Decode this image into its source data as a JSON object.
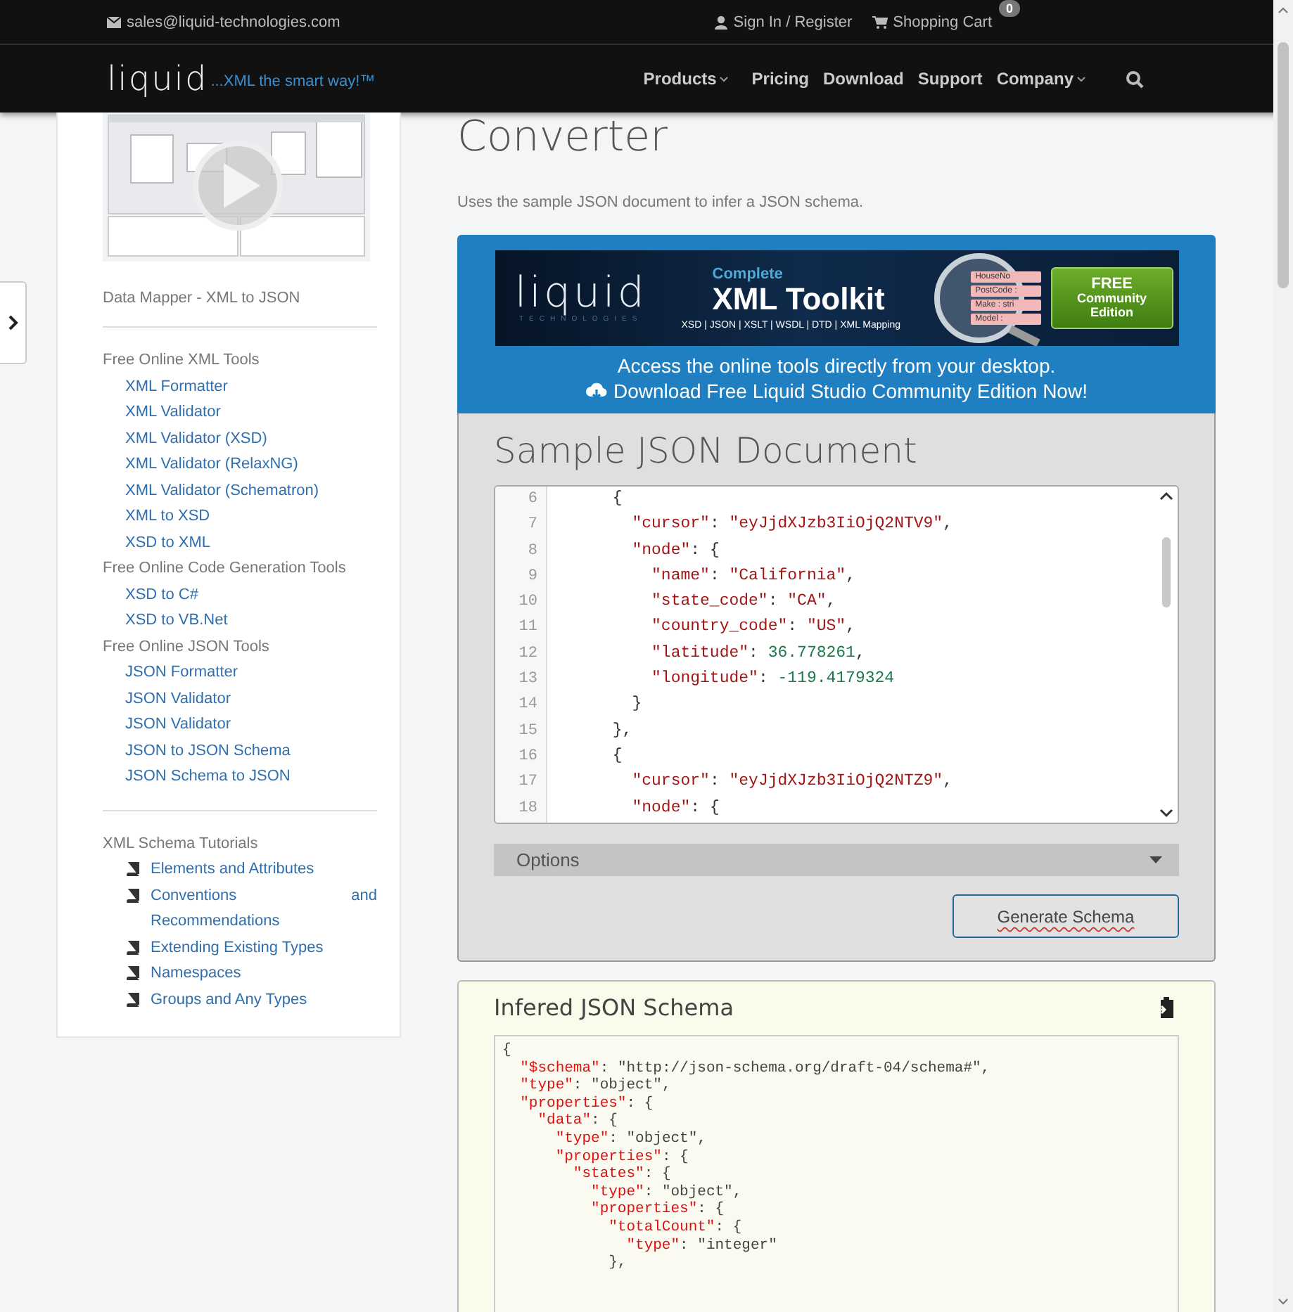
{
  "topbar": {
    "email": "sales@liquid-technologies.com",
    "sign_in": "Sign In / Register",
    "cart": "Shopping Cart",
    "cart_count": "0"
  },
  "header": {
    "logo": "liquid",
    "tagline": "...XML the smart way!™"
  },
  "nav": [
    {
      "label": "Products",
      "dropdown": true
    },
    {
      "label": "Pricing",
      "dropdown": false
    },
    {
      "label": "Download",
      "dropdown": false
    },
    {
      "label": "Support",
      "dropdown": false
    },
    {
      "label": "Company",
      "dropdown": true
    }
  ],
  "sidebar": {
    "video_caption": "Data Mapper - XML to JSON",
    "groups": [
      {
        "title": "Free Online XML Tools",
        "links": [
          "XML Formatter",
          "XML Validator",
          "XML Validator (XSD)",
          "XML Validator (RelaxNG)",
          "XML Validator (Schematron)",
          "XML to XSD",
          "XSD to XML"
        ]
      },
      {
        "title": "Free Online Code Generation Tools",
        "links": [
          "XSD to C#",
          "XSD to VB.Net"
        ]
      },
      {
        "title": "Free Online JSON Tools",
        "links": [
          "JSON Formatter",
          "JSON Validator",
          "JSON Validator",
          "JSON to JSON Schema",
          "JSON Schema to JSON"
        ]
      }
    ],
    "tutorials": {
      "title": "XML Schema Tutorials",
      "items": [
        "Elements and Attributes",
        "Conventions and Recommendations",
        "Extending Existing Types",
        "Namespaces",
        "Groups and Any Types"
      ]
    }
  },
  "page": {
    "title": "Converter",
    "description": "Uses the sample JSON document to infer a JSON schema."
  },
  "promo": {
    "banner": {
      "logo": "liquid",
      "logo_sub": "TECHNOLOGIES",
      "kicker": "Complete",
      "title": "XML Toolkit",
      "formats": "XSD | JSON | XSLT | WSDL | DTD | XML Mapping",
      "elements": [
        "HouseNo",
        "PostCode :",
        "Make : stri",
        "Model :"
      ],
      "badge_top": "FREE",
      "badge_bottom": "Community Edition"
    },
    "line1": "Access the online tools directly from your desktop.",
    "line2": "Download Free Liquid Studio Community Edition Now!"
  },
  "sample": {
    "title": "Sample JSON Document",
    "lines": [
      {
        "number": "6",
        "text": "      {"
      },
      {
        "number": "7",
        "text": "        \"cursor\": \"eyJjdXJzb3IiOjQ2NTV9\","
      },
      {
        "number": "8",
        "text": "        \"node\": {"
      },
      {
        "number": "9",
        "text": "          \"name\": \"California\","
      },
      {
        "number": "10",
        "text": "          \"state_code\": \"CA\","
      },
      {
        "number": "11",
        "text": "          \"country_code\": \"US\","
      },
      {
        "number": "12",
        "text": "          \"latitude\": 36.778261,"
      },
      {
        "number": "13",
        "text": "          \"longitude\": -119.4179324"
      },
      {
        "number": "14",
        "text": "        }"
      },
      {
        "number": "15",
        "text": "      },"
      },
      {
        "number": "16",
        "text": "      {"
      },
      {
        "number": "17",
        "text": "        \"cursor\": \"eyJjdXJzb3IiOjQ2NTZ9\","
      },
      {
        "number": "18",
        "text": "        \"node\": {"
      }
    ],
    "options": "Options",
    "button": "Generate Schema"
  },
  "schema": {
    "title": "Infered JSON Schema",
    "lines": [
      "{",
      "  \"$schema\": \"http://json-schema.org/draft-04/schema#\",",
      "  \"type\": \"object\",",
      "  \"properties\": {",
      "    \"data\": {",
      "      \"type\": \"object\",",
      "      \"properties\": {",
      "        \"states\": {",
      "          \"type\": \"object\",",
      "          \"properties\": {",
      "            \"totalCount\": {",
      "              \"type\": \"integer\"",
      "            },"
    ]
  }
}
